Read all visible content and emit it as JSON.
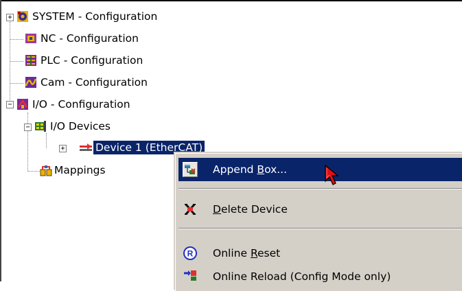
{
  "tree": {
    "items": [
      {
        "label": "SYSTEM - Configuration",
        "icon": "system-config-icon"
      },
      {
        "label": "NC - Configuration",
        "icon": "nc-config-icon"
      },
      {
        "label": "PLC - Configuration",
        "icon": "plc-config-icon"
      },
      {
        "label": "Cam - Configuration",
        "icon": "cam-config-icon"
      },
      {
        "label": "I/O - Configuration",
        "icon": "io-config-icon"
      },
      {
        "label": "I/O Devices",
        "icon": "io-devices-icon"
      },
      {
        "label": "Device 1 (EtherCAT)",
        "icon": "ethercat-device-icon",
        "selected": true
      },
      {
        "label": "Mappings",
        "icon": "mappings-icon"
      }
    ],
    "expanders": {
      "collapsed": "+",
      "expanded": "−"
    }
  },
  "context_menu": {
    "items": [
      {
        "pre": "Append ",
        "key": "B",
        "post": "ox...",
        "highlighted": true,
        "icon": "append-box-icon"
      },
      {
        "pre": "",
        "key": "D",
        "post": "elete Device",
        "icon": "delete-device-icon"
      },
      {
        "pre": "Online ",
        "key": "R",
        "post": "eset",
        "icon": "online-reset-icon"
      },
      {
        "pre": "Online Reload (Config Mode only)",
        "key": "",
        "post": "",
        "icon": "online-reload-icon"
      }
    ]
  },
  "colors": {
    "selection": "#0a246a",
    "menu_bg": "#d4d0c8"
  }
}
